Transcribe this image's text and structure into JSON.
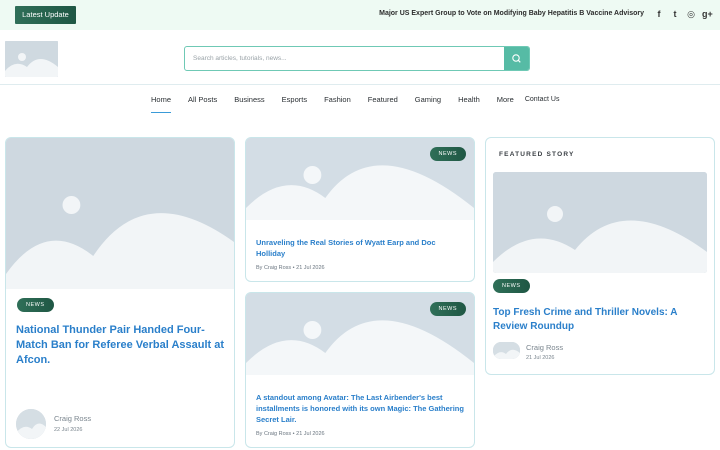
{
  "topbar": {
    "latest_label": "Latest Update",
    "ticker": "Major US Expert Group to Vote on Modifying Baby Hepatitis B Vaccine Advisory",
    "socials": [
      {
        "icon": "facebook-icon",
        "glyph": "f"
      },
      {
        "icon": "twitter-icon",
        "glyph": "t"
      },
      {
        "icon": "instagram-icon",
        "glyph": "◎"
      },
      {
        "icon": "google-plus-icon",
        "glyph": "g+"
      }
    ]
  },
  "search": {
    "placeholder": "Search articles, tutorials, news..."
  },
  "nav": {
    "items": [
      "Home",
      "All Posts",
      "Business",
      "Esports",
      "Fashion",
      "Featured",
      "Gaming",
      "Health",
      "More"
    ],
    "contact": "Contact Us"
  },
  "cards": {
    "main": {
      "badge": "NEWS",
      "title": "National Thunder Pair Handed Four-Match Ban for Referee Verbal Assault at Afcon.",
      "author": "Craig Ross",
      "date": "22 Jul 2026"
    },
    "middle_top": {
      "badge": "NEWS",
      "title": "Unraveling the Real Stories of Wyatt Earp and Doc Holliday",
      "meta": "By Craig Ross  • 21 Jul 2026"
    },
    "middle_bottom": {
      "badge": "NEWS",
      "title": "A standout among Avatar: The Last Airbender's best installments is honored with its own Magic: The Gathering Secret Lair.",
      "meta": "By Craig Ross  • 21 Jul 2026"
    },
    "featured": {
      "label": "FEATURED STORY",
      "badge": "NEWS",
      "title": "Top Fresh Crime and Thriller Novels: A Review Roundup",
      "author": "Craig Ross",
      "date": "21 Jul 2026"
    }
  },
  "colors": {
    "accent": "#2a7fca",
    "brand": "#2f6f58",
    "search_button": "#56bba5"
  }
}
